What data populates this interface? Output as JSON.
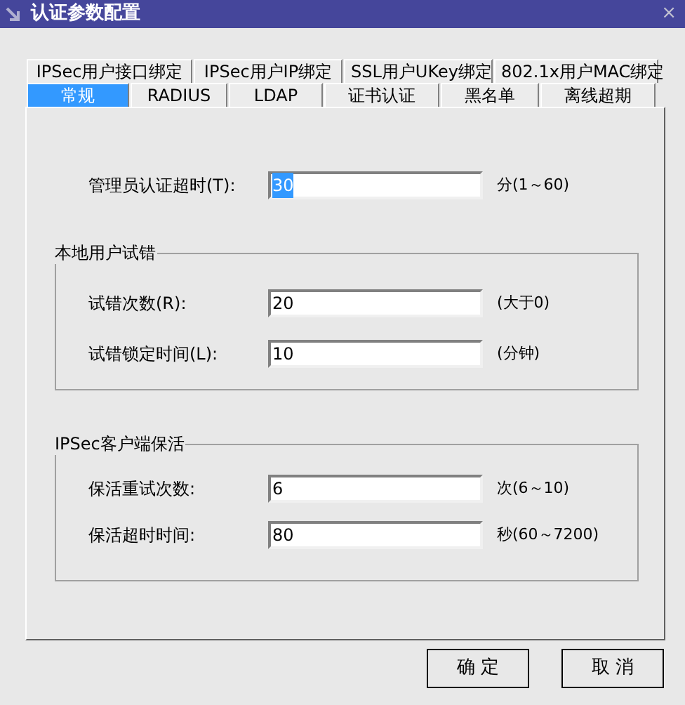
{
  "window": {
    "title": "认证参数配置",
    "close": "×"
  },
  "tabs_row_1": [
    {
      "label": "IPSec用户接口绑定",
      "selected": false
    },
    {
      "label": "IPSec用户IP绑定",
      "selected": false
    },
    {
      "label": "SSL用户UKey绑定",
      "selected": false
    },
    {
      "label": "802.1x用户MAC绑定",
      "selected": false
    }
  ],
  "tabs_row_2": [
    {
      "label": "常规",
      "selected": true
    },
    {
      "label": "RADIUS",
      "selected": false
    },
    {
      "label": "LDAP",
      "selected": false
    },
    {
      "label": "证书认证",
      "selected": false
    },
    {
      "label": "黑名单",
      "selected": false
    },
    {
      "label": "离线超期",
      "selected": false
    }
  ],
  "admin_timeout": {
    "label": "管理员认证超时(T):",
    "value": "30",
    "value_selected": true,
    "hint": "分(1～60)"
  },
  "groups": [
    {
      "title": "本地用户试错",
      "fields": [
        {
          "label": "试错次数(R):",
          "value": "20",
          "hint": "(大于0)"
        },
        {
          "label": "试错锁定时间(L):",
          "value": "10",
          "hint": "(分钟)"
        }
      ]
    },
    {
      "title": "IPSec客户端保活",
      "fields": [
        {
          "label": "保活重试次数:",
          "value": "6",
          "hint": "次(6～10)"
        },
        {
          "label": "保活超时时间:",
          "value": "80",
          "hint": "秒(60～7200)"
        }
      ]
    }
  ],
  "buttons": [
    "确 定",
    "取 消"
  ]
}
